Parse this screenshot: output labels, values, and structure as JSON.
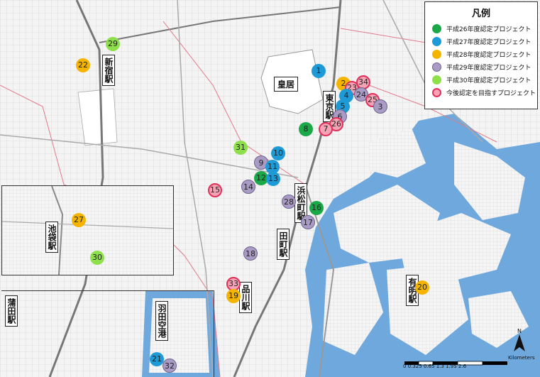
{
  "legend": {
    "title": "凡例",
    "items": [
      {
        "label": "平成26年度認定プロジェクト",
        "color": "#1aa849",
        "kind": "green"
      },
      {
        "label": "平成27年度認定プロジェクト",
        "color": "#1e9bd7",
        "kind": "blue"
      },
      {
        "label": "平成28年度認定プロジェクト",
        "color": "#f5b400",
        "kind": "orange"
      },
      {
        "label": "平成29年度認定プロジェクト",
        "color": "#a99bc4",
        "kind": "purple"
      },
      {
        "label": "平成30年度認定プロジェクト",
        "color": "#8ee04a",
        "kind": "lime"
      },
      {
        "label": "今後認定を目指すプロジェクト",
        "color": "#f5a3b5",
        "kind": "pink"
      }
    ]
  },
  "places": {
    "palace": "皇居",
    "tokyo": "東京駅",
    "shinjuku": "新宿駅",
    "hamamatsucho": "浜松町駅",
    "tamachi": "田町駅",
    "shinagawa": "品川駅",
    "ariake": "有明駅",
    "ikebukuro": "池袋駅",
    "kamata": "蒲田駅",
    "haneda": "羽田空港"
  },
  "markers": [
    {
      "n": "1",
      "kind": "blue"
    },
    {
      "n": "2",
      "kind": "orange"
    },
    {
      "n": "23",
      "kind": "pink"
    },
    {
      "n": "34",
      "kind": "pink"
    },
    {
      "n": "4",
      "kind": "blue"
    },
    {
      "n": "24",
      "kind": "purple"
    },
    {
      "n": "25",
      "kind": "pink"
    },
    {
      "n": "3",
      "kind": "purple"
    },
    {
      "n": "5",
      "kind": "blue"
    },
    {
      "n": "6",
      "kind": "purple"
    },
    {
      "n": "26",
      "kind": "pink"
    },
    {
      "n": "7",
      "kind": "pink"
    },
    {
      "n": "8",
      "kind": "green"
    },
    {
      "n": "31",
      "kind": "lime"
    },
    {
      "n": "10",
      "kind": "blue"
    },
    {
      "n": "9",
      "kind": "purple"
    },
    {
      "n": "11",
      "kind": "blue"
    },
    {
      "n": "12",
      "kind": "green"
    },
    {
      "n": "13",
      "kind": "blue"
    },
    {
      "n": "14",
      "kind": "purple"
    },
    {
      "n": "15",
      "kind": "pink"
    },
    {
      "n": "28",
      "kind": "purple"
    },
    {
      "n": "16",
      "kind": "green"
    },
    {
      "n": "17",
      "kind": "purple"
    },
    {
      "n": "18",
      "kind": "purple"
    },
    {
      "n": "33",
      "kind": "pink"
    },
    {
      "n": "19",
      "kind": "orange"
    },
    {
      "n": "20",
      "kind": "orange"
    },
    {
      "n": "29",
      "kind": "lime"
    },
    {
      "n": "22",
      "kind": "orange"
    },
    {
      "n": "27",
      "kind": "orange"
    },
    {
      "n": "30",
      "kind": "lime"
    },
    {
      "n": "21",
      "kind": "blue"
    },
    {
      "n": "32",
      "kind": "purple"
    }
  ],
  "scale": {
    "labels": "0 0.325 0.65    1.3    1.95    2.6",
    "unit": "Kilometers"
  },
  "north": "N"
}
